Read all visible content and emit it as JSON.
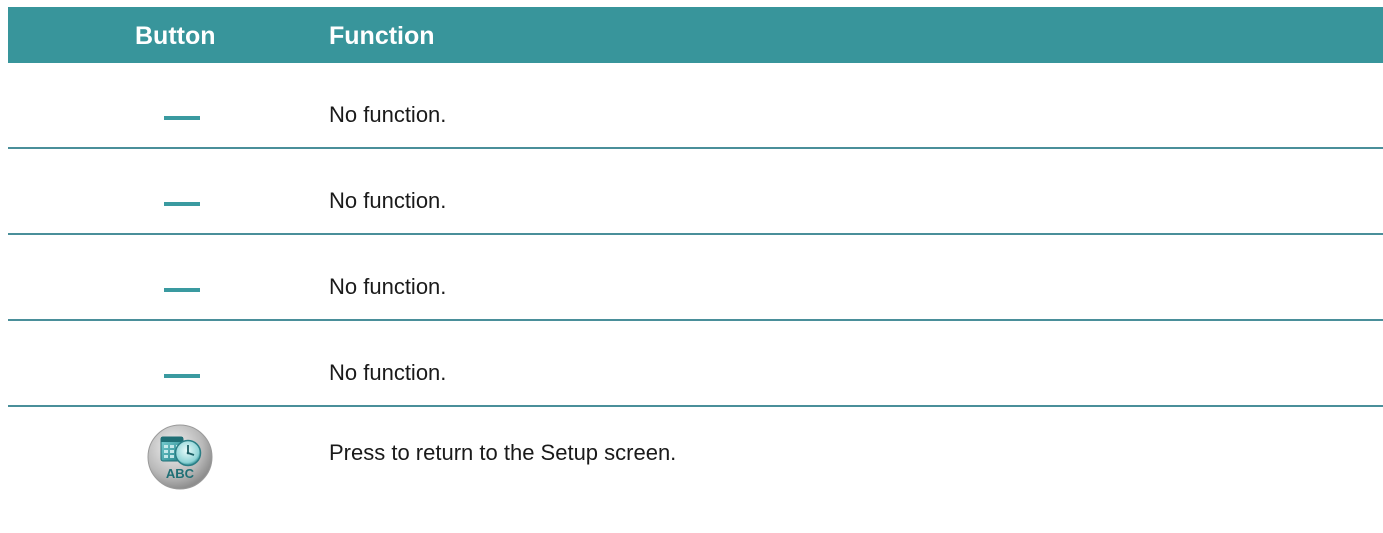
{
  "table": {
    "header": {
      "button": "Button",
      "function": "Function"
    },
    "rows": [
      {
        "button_icon": "dash-icon",
        "function": "No function."
      },
      {
        "button_icon": "dash-icon",
        "function": "No function."
      },
      {
        "button_icon": "dash-icon",
        "function": "No function."
      },
      {
        "button_icon": "dash-icon",
        "function": "No function."
      },
      {
        "button_icon": "setup-abc-clock-icon",
        "function": "Press to return to the Setup screen."
      }
    ]
  },
  "colors": {
    "header_bg": "#38959b",
    "header_text": "#ffffff",
    "divider": "#4a8f9a",
    "dash": "#3a9aa0"
  }
}
